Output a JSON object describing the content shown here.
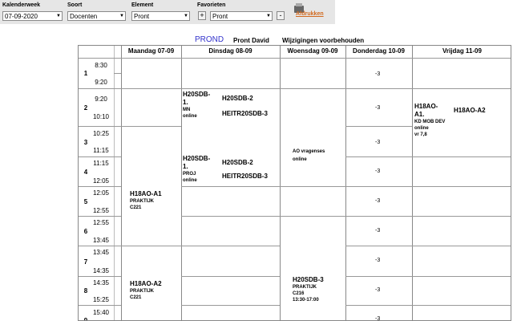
{
  "toolbar": {
    "kalenderweek": {
      "label": "Kalenderweek",
      "value": "07-09-2020"
    },
    "soort": {
      "label": "Soort",
      "value": "Docenten"
    },
    "element": {
      "label": "Element",
      "value": "Pront"
    },
    "favorieten": {
      "label": "Favorieten",
      "value": "Pront",
      "add": "+",
      "remove": "-"
    },
    "print_label": "Afdrukken"
  },
  "header": {
    "code": "PROND",
    "name": "Pront David",
    "note": "Wijzigingen voorbehouden"
  },
  "days": [
    "Maandag 07-09",
    "Dinsdag 08-09",
    "Woensdag 09-09",
    "Donderdag 10-09",
    "Vrijdag 11-09"
  ],
  "periods": [
    {
      "num": "1",
      "start": "8:30",
      "end": "9:20"
    },
    {
      "num": "2",
      "start": "9:20",
      "end": "10:10"
    },
    {
      "num": "3",
      "start": "10:25",
      "end": "11:15"
    },
    {
      "num": "4",
      "start": "11:15",
      "end": "12:05"
    },
    {
      "num": "5",
      "start": "12:05",
      "end": "12:55"
    },
    {
      "num": "6",
      "start": "12:55",
      "end": "13:45"
    },
    {
      "num": "7",
      "start": "13:45",
      "end": "14:35"
    },
    {
      "num": "8",
      "start": "14:35",
      "end": "15:25"
    },
    {
      "num": "9",
      "start": "15:40",
      "end": ""
    }
  ],
  "lessons": {
    "mon_a": {
      "code": "H18AO-A1",
      "l1": "PRAKTIJK",
      "l2": "C221"
    },
    "mon_b": {
      "code": "H18AO-A2",
      "l1": "PRAKTIJK",
      "l2": "C221"
    },
    "tue_a": {
      "code1": "H20SDB-",
      "code2": "1.",
      "l1": "MN",
      "l2": "online",
      "r1": "H20SDB-2",
      "r2": "HEITR20SDB-3"
    },
    "tue_b": {
      "code1": "H20SDB-",
      "code2": "1.",
      "l1": "PROJ",
      "l2": "online",
      "r1": "H20SDB-2",
      "r2": "HEITR20SDB-3"
    },
    "wed_a": {
      "l1": "AO vragenses",
      "l2": "online"
    },
    "wed_b": {
      "code": "H20SDB-3",
      "l1": "PRAKTIJK",
      "l2": "C216",
      "l3": "13:30-17:00"
    },
    "thu": "-3",
    "fri": {
      "code1": "H18AO-",
      "code2": "A1.",
      "l1": "KD MOB DEV",
      "l2": "online",
      "l3": "vr 7,8",
      "r1": "H18AO-A2"
    }
  }
}
